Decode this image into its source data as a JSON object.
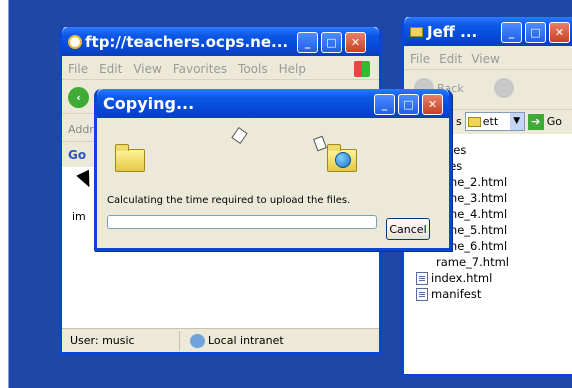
{
  "desktop": {
    "bg": "#1e47a8"
  },
  "ftp_window": {
    "title": "ftp://teachers.ocps.ne...",
    "menu": [
      "File",
      "Edit",
      "View",
      "Favorites",
      "Tools",
      "Help"
    ],
    "address_label": "Addr",
    "google_label": "Go",
    "left_cut_text": "im",
    "status_user": "User: music",
    "status_zone": "Local intranet"
  },
  "jeff_window": {
    "title": "Jeff ...",
    "menu": [
      "File",
      "Edit",
      "View"
    ],
    "back_label": "Back",
    "addr_label": "s",
    "addr_value": "ett",
    "go_label": "Go",
    "files": [
      "ges",
      "ies",
      "me_2.html",
      "me_3.html",
      "me_4.html",
      "me_5.html",
      "me_6.html",
      "rame_7.html",
      "index.html",
      "manifest"
    ]
  },
  "copy_dialog": {
    "title": "Copying...",
    "message": "Calculating the time required to upload the files.",
    "progress": 0,
    "cancel_label": "Cancel"
  }
}
